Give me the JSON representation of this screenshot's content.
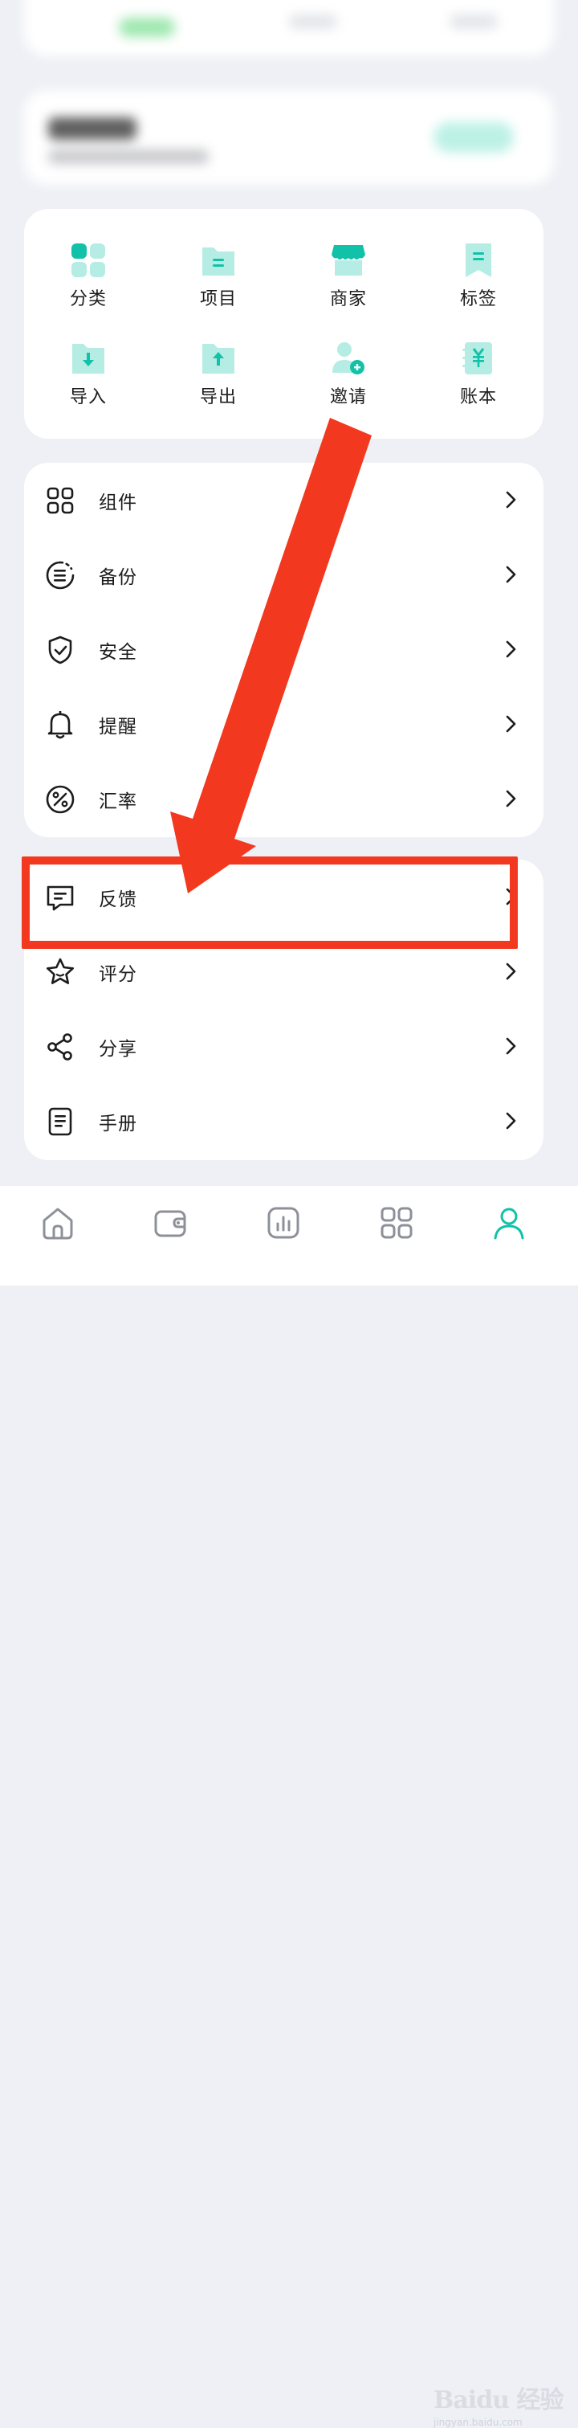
{
  "quick_actions": [
    {
      "label": "分类",
      "icon": "category-icon"
    },
    {
      "label": "项目",
      "icon": "project-folder-icon"
    },
    {
      "label": "商家",
      "icon": "store-icon"
    },
    {
      "label": "标签",
      "icon": "bookmark-tag-icon"
    },
    {
      "label": "导入",
      "icon": "import-folder-icon"
    },
    {
      "label": "导出",
      "icon": "export-folder-icon"
    },
    {
      "label": "邀请",
      "icon": "invite-user-icon"
    },
    {
      "label": "账本",
      "icon": "ledger-yen-icon"
    }
  ],
  "settings_group1": [
    {
      "label": "组件",
      "icon": "widgets-grid-icon"
    },
    {
      "label": "备份",
      "icon": "backup-icon"
    },
    {
      "label": "安全",
      "icon": "shield-check-icon"
    },
    {
      "label": "提醒",
      "icon": "bell-icon"
    },
    {
      "label": "汇率",
      "icon": "percent-icon"
    }
  ],
  "settings_group2": [
    {
      "label": "反馈",
      "icon": "feedback-message-icon"
    },
    {
      "label": "评分",
      "icon": "star-icon"
    },
    {
      "label": "分享",
      "icon": "share-icon"
    },
    {
      "label": "手册",
      "icon": "manual-document-icon"
    }
  ],
  "tabbar": [
    {
      "name": "home",
      "icon": "home-icon"
    },
    {
      "name": "wallet",
      "icon": "wallet-icon"
    },
    {
      "name": "stats",
      "icon": "chart-icon"
    },
    {
      "name": "apps",
      "icon": "apps-grid-icon"
    },
    {
      "name": "profile",
      "icon": "profile-icon",
      "active": true
    }
  ],
  "watermark": {
    "logo": "Baidu 经验",
    "sub": "jingyan.baidu.com"
  },
  "colors": {
    "accent": "#12c2a8",
    "accent_light": "#b5ece3",
    "annotation": "#f2381e",
    "background": "#eef0f5"
  }
}
